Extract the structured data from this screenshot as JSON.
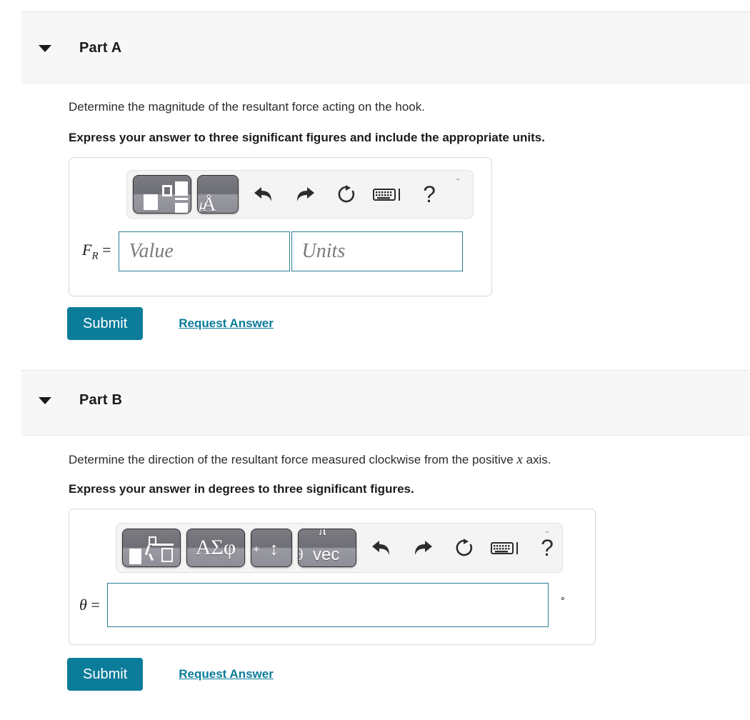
{
  "theme": {
    "accent": "#0b7c99",
    "header_bg": "#f7f7f7",
    "input_border": "#2a7d96",
    "toolbar_bg": "#f4f4f4",
    "key_gray": "#7b7b82"
  },
  "parts": [
    {
      "id": "A",
      "title": "Part A",
      "caret": "caret-down-icon",
      "prompt": "Determine the magnitude of the resultant force acting on the hook.",
      "instruction": "Express your answer to three significant figures and include the appropriate units.",
      "toolbar": {
        "template_keys": [
          {
            "name": "math-template-boxes",
            "glyph": ""
          },
          {
            "name": "math-units-angstrom",
            "glyph": "Å"
          }
        ],
        "commands": [
          {
            "name": "undo-icon",
            "label": "undo"
          },
          {
            "name": "redo-icon",
            "label": "redo"
          },
          {
            "name": "reset-icon",
            "label": "reset"
          },
          {
            "name": "keyboard-icon",
            "label": "keyboard"
          },
          {
            "name": "help-icon",
            "label": "?"
          }
        ]
      },
      "answer": {
        "variable": "F",
        "subscript": "R",
        "equals": "=",
        "value_placeholder": "Value",
        "value_text": "",
        "units_placeholder": "Units",
        "units_text": ""
      },
      "submit_label": "Submit",
      "request_label": "Request Answer"
    },
    {
      "id": "B",
      "title": "Part B",
      "caret": "caret-down-icon",
      "prompt_before": "Determine the direction of the resultant force measured clockwise from the positive ",
      "prompt_var": "x",
      "prompt_after": " axis.",
      "instruction": "Express your answer in degrees to three significant figures.",
      "toolbar": {
        "template_keys": [
          {
            "name": "math-template-radical",
            "glyph": ""
          },
          {
            "name": "greek-symbols-key",
            "glyph": "ΑΣφ"
          },
          {
            "name": "math-operators-key",
            "glyph": "↕"
          },
          {
            "name": "vector-key",
            "glyph": "vec"
          }
        ],
        "commands": [
          {
            "name": "undo-icon",
            "label": "undo"
          },
          {
            "name": "redo-icon",
            "label": "redo"
          },
          {
            "name": "reset-icon",
            "label": "reset"
          },
          {
            "name": "keyboard-icon",
            "label": "keyboard"
          },
          {
            "name": "help-icon",
            "label": "?"
          }
        ]
      },
      "answer": {
        "variable": "θ",
        "equals": "=",
        "value_text": "",
        "value_placeholder": "",
        "unit_suffix": "∘"
      },
      "submit_label": "Submit",
      "request_label": "Request Answer"
    }
  ]
}
